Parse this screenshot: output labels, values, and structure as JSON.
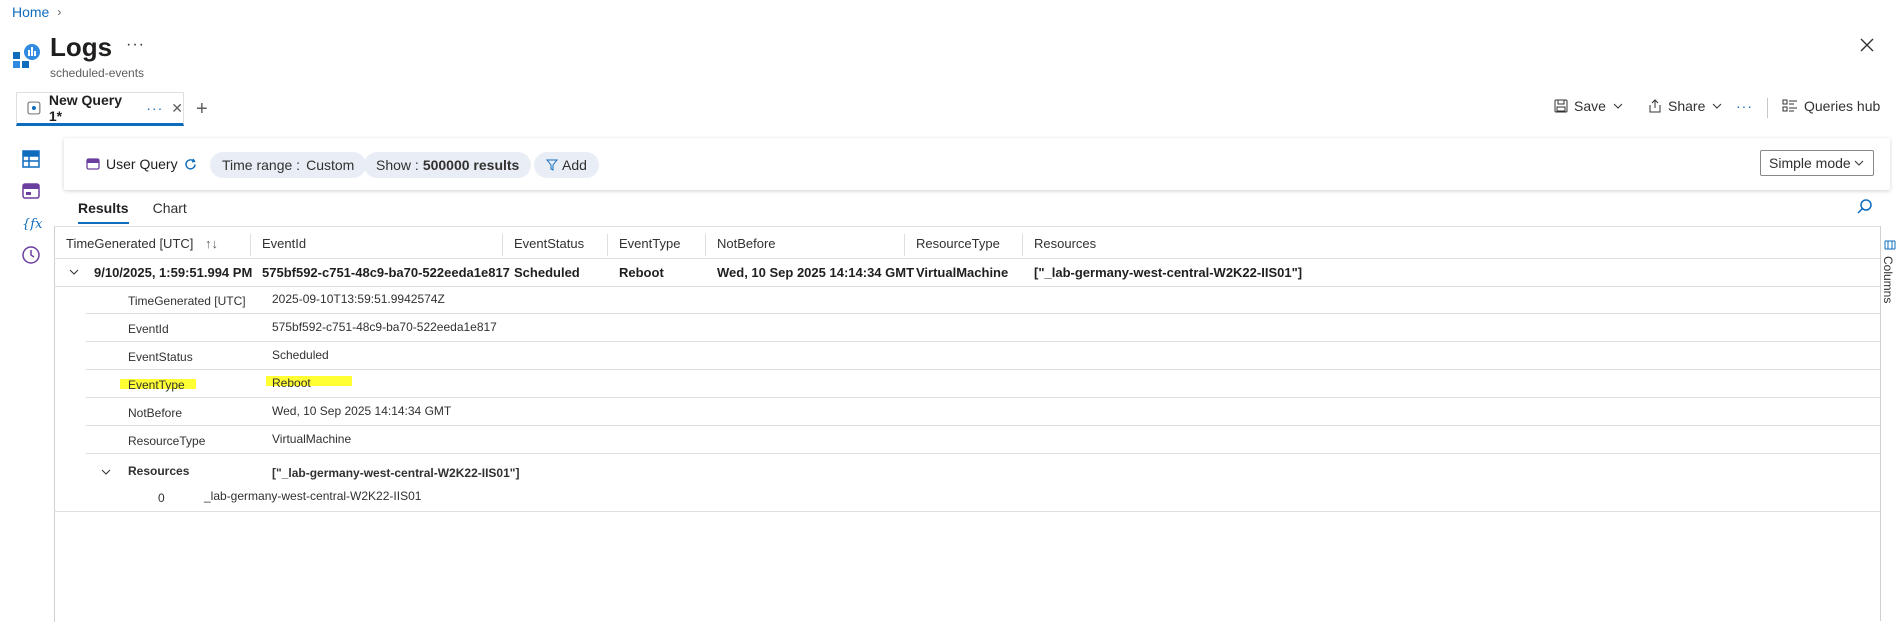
{
  "breadcrumb": {
    "home": "Home",
    "separator": "›"
  },
  "header": {
    "title": "Logs",
    "more": "···",
    "subtitle": "scheduled-events",
    "close_icon": "close-icon"
  },
  "tabs": {
    "items": [
      {
        "label": "New Query 1*",
        "more": "···",
        "close": "✕"
      }
    ],
    "add": "+"
  },
  "toolbar": {
    "save": "Save",
    "share": "Share",
    "more": "···",
    "queries_hub": "Queries hub"
  },
  "querybar": {
    "user_query": "User Query",
    "time_range_label": "Time range :",
    "time_range_value": "Custom",
    "show_label": "Show :",
    "show_value": "500000 results",
    "add": "Add",
    "mode": "Simple mode"
  },
  "results_tabs": [
    "Results",
    "Chart"
  ],
  "columns_label": "Columns",
  "table": {
    "headers": [
      "TimeGenerated [UTC]",
      "EventId",
      "EventStatus",
      "EventType",
      "NotBefore",
      "ResourceType",
      "Resources"
    ],
    "sort_indicator": "↑↓",
    "row": [
      "9/10/2025, 1:59:51.994 PM",
      "575bf592-c751-48c9-ba70-522eeda1e817",
      "Scheduled",
      "Reboot",
      "Wed, 10 Sep 2025 14:14:34 GMT",
      "VirtualMachine",
      "[\"_lab-germany-west-central-W2K22-IIS01\"]"
    ],
    "details": [
      {
        "label": "TimeGenerated [UTC]",
        "value": "2025-09-10T13:59:51.9942574Z"
      },
      {
        "label": "EventId",
        "value": "575bf592-c751-48c9-ba70-522eeda1e817"
      },
      {
        "label": "EventStatus",
        "value": "Scheduled"
      },
      {
        "label": "EventType",
        "value": "Reboot"
      },
      {
        "label": "NotBefore",
        "value": "Wed, 10 Sep 2025 14:14:34 GMT"
      },
      {
        "label": "ResourceType",
        "value": "VirtualMachine"
      },
      {
        "label": "Resources",
        "value": "[\"_lab-germany-west-central-W2K22-IIS01\"]"
      }
    ],
    "resource_item": {
      "index": "0",
      "value": "_lab-germany-west-central-W2K22-IIS01"
    }
  },
  "colors": {
    "accent": "#0f6cbd",
    "highlight": "#ffff33"
  }
}
